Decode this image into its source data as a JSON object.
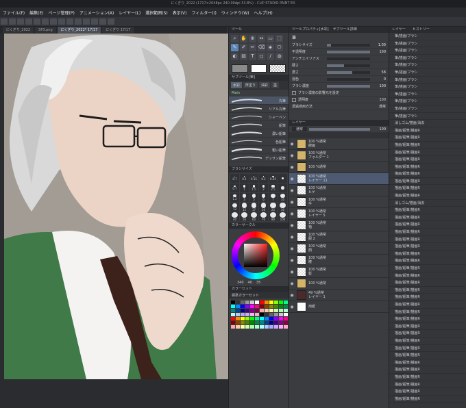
{
  "window": {
    "title": "にくぎり_2022 (1717×2048px 240.00dpi 33.8%) - CLIP STUDIO PAINT EX"
  },
  "menu": [
    "ファイル(F)",
    "編集(E)",
    "ページ管理(P)",
    "アニメーション(A)",
    "レイヤー(L)",
    "選択範囲(S)",
    "表示(V)",
    "フィルター(I)",
    "ウィンドウ(W)",
    "ヘルプ(H)"
  ],
  "doc_tabs": [
    "にくぎり_2022",
    "SP3.png",
    "にくぎり_2022* 17/17",
    "にくぎり 17/17"
  ],
  "tool_panel": {
    "tools_header": "ツール",
    "tools": [
      "⌕",
      "✋",
      "⊕",
      "↔",
      "▭",
      "⬚",
      "✎",
      "✐",
      "✏",
      "⌫",
      "◈",
      "⎔",
      "◐",
      "▤",
      "T",
      "◻",
      "/",
      "◍"
    ],
    "subtool_header": "サブツール[筆]",
    "subtool_tabs": [
      "水彩",
      "厚塗り",
      "油彩",
      "墨"
    ],
    "brush_group": "Main",
    "brushes": [
      "丸筆",
      "リアル丸筆",
      "シャーペン",
      "鉛筆",
      "濃い鉛筆",
      "色鉛筆",
      "粗い鉛筆",
      "デッサン鉛筆"
    ],
    "brush_size_header": "ブラシサイズ",
    "brush_sizes": [
      "0.7",
      "0.1",
      "0.15",
      "0.2",
      "0.25",
      "",
      "0.7",
      "1",
      "1.5",
      "2",
      "2.5",
      "",
      "1.2",
      "3",
      "5",
      "6",
      "7",
      "10",
      "12",
      "15",
      "17",
      "20",
      "25",
      "30",
      "40",
      "50",
      "60",
      "70",
      "80",
      "100"
    ],
    "color_header": "カラーサークル",
    "color_values": {
      "h": "340",
      "s": "40",
      "v": "35"
    },
    "palette_header": "カラーセット",
    "palette_name": "標準カラーセット"
  },
  "prop_panel": {
    "header": "筆",
    "tabs": [
      "ツールプロパティ[水彩]",
      "サブツール詳細"
    ],
    "props": [
      {
        "label": "ブラシサイズ",
        "value": "1.00",
        "fill": 0.1
      },
      {
        "label": "不透明度",
        "value": "100",
        "fill": 1.0
      },
      {
        "label": "アンチエイリアス",
        "value": "",
        "fill": 0
      },
      {
        "label": "硬さ",
        "value": "",
        "fill": 0.4
      },
      {
        "label": "濃さ",
        "value": "58",
        "fill": 0.58
      },
      {
        "label": "混色",
        "value": "0",
        "fill": 0
      },
      {
        "label": "ブラシ濃度",
        "value": "100",
        "fill": 1.0
      }
    ],
    "checks": [
      "ブラシ濃度の影響元を設定",
      "透明度",
      "透過適用方法"
    ],
    "check_values": [
      "",
      "100",
      "通常"
    ],
    "layer_header": "レイヤー",
    "blend_mode": "通常",
    "opacity": "100",
    "layers": [
      {
        "pct": "100 %通常",
        "name": "線画",
        "kind": "folder",
        "sel": false
      },
      {
        "pct": "100 %通常",
        "name": "フォルダー 1",
        "kind": "folder",
        "sel": false
      },
      {
        "pct": "100 %通常",
        "name": "",
        "kind": "folder",
        "sel": false
      },
      {
        "pct": "100 %通常",
        "name": "レイヤー 11",
        "kind": "raster",
        "sel": true
      },
      {
        "pct": "100 %通常",
        "name": "ヒゲ",
        "kind": "raster",
        "sel": false
      },
      {
        "pct": "100 %通常",
        "name": "手",
        "kind": "raster",
        "sel": false
      },
      {
        "pct": "100 %通常",
        "name": "レイヤー 5",
        "kind": "raster",
        "sel": false
      },
      {
        "pct": "100 %通常",
        "name": "袖",
        "kind": "raster",
        "sel": false
      },
      {
        "pct": "100 %通常",
        "name": "服 2",
        "kind": "raster",
        "sel": false
      },
      {
        "pct": "100 %通常",
        "name": "顔",
        "kind": "raster",
        "sel": false
      },
      {
        "pct": "100 %通常",
        "name": "瞳",
        "kind": "raster",
        "sel": false
      },
      {
        "pct": "100 %通常",
        "name": "髪",
        "kind": "raster",
        "sel": false
      },
      {
        "pct": "100 %通常",
        "name": "",
        "kind": "folder",
        "sel": false
      },
      {
        "pct": "49 %通常",
        "name": "レイヤー 1",
        "kind": "dark",
        "sel": false
      },
      {
        "pct": "",
        "name": "用紙",
        "kind": "white",
        "sel": false
      }
    ]
  },
  "history": {
    "tabs": [
      "レイヤー",
      "ヒストリー"
    ],
    "items": [
      "筆/描画/ブラシ",
      "筆/描画/ブラシ",
      "筆/描画/ブラシ",
      "筆/描画/ブラシ",
      "筆/描画/ブラシ",
      "筆/描画/ブラシ",
      "筆/描画/ブラシ",
      "筆/描画/ブラシ",
      "筆/描画/ブラシ",
      "筆/描画/ブラシ",
      "筆/描画/ブラシ",
      "筆/描画/ブラシ",
      "消しゴム/描画/消去",
      "描画/鉛筆/描画R",
      "描画/鉛筆/描画R",
      "描画/鉛筆/描画R",
      "描画/鉛筆/描画R",
      "描画/鉛筆/描画R",
      "描画/鉛筆/描画R",
      "描画/鉛筆/描画R",
      "描画/鉛筆/描画R",
      "描画/鉛筆/描画R",
      "描画/鉛筆/描画R",
      "消しゴム/描画/消去",
      "描画/鉛筆/描画R",
      "描画/鉛筆/描画R",
      "描画/鉛筆/描画R",
      "描画/鉛筆/描画R",
      "描画/鉛筆/描画R",
      "描画/鉛筆/描画R",
      "描画/鉛筆/描画R",
      "描画/鉛筆/描画R",
      "描画/鉛筆/描画R",
      "描画/鉛筆/描画R",
      "描画/鉛筆/描画R",
      "描画/鉛筆/描画R",
      "描画/鉛筆/描画R",
      "描画/鉛筆/描画R",
      "描画/鉛筆/描画R",
      "描画/鉛筆/描画R",
      "描画/鉛筆/描画R",
      "描画/鉛筆/描画R",
      "描画/鉛筆/描画R",
      "描画/鉛筆/描画R",
      "描画/鉛筆/描画R",
      "描画/鉛筆/描画R",
      "描画/鉛筆/描画R",
      "描画/鉛筆/描画R",
      "描画/鉛筆/描画R",
      "描画/鉛筆/描画R",
      "描画/鉛筆/描画R"
    ]
  },
  "colors": {
    "accent": "#5b86b6",
    "selected_layer": "#4e5a72",
    "canvas_bg": "#a39c95",
    "vest": "#3f7a48"
  }
}
